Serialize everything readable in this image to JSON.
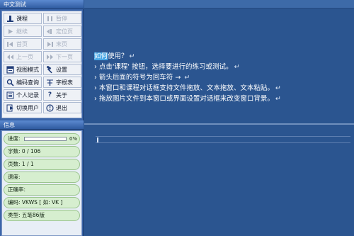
{
  "panel": {
    "title": "中文测试"
  },
  "buttons": [
    {
      "label": "课程",
      "icon": "course-icon",
      "enabled": true
    },
    {
      "label": "暂停",
      "icon": "pause-icon",
      "enabled": false
    },
    {
      "label": "继续",
      "icon": "resume-icon",
      "enabled": false
    },
    {
      "label": "定位页",
      "icon": "locate-page-icon",
      "enabled": false
    },
    {
      "label": "首页",
      "icon": "first-page-icon",
      "enabled": false
    },
    {
      "label": "末页",
      "icon": "last-page-icon",
      "enabled": false
    },
    {
      "label": "上一页",
      "icon": "prev-page-icon",
      "enabled": false
    },
    {
      "label": "下一页",
      "icon": "next-page-icon",
      "enabled": false
    },
    {
      "label": "视图模式",
      "icon": "view-mode-icon",
      "enabled": true
    },
    {
      "label": "设置",
      "icon": "hammer-icon",
      "enabled": true
    },
    {
      "label": "编码查询",
      "icon": "search-icon",
      "enabled": true
    },
    {
      "label": "字根表",
      "icon": "radical-table-icon",
      "enabled": true
    },
    {
      "label": "个人记录",
      "icon": "record-icon",
      "enabled": true
    },
    {
      "label": "关于",
      "icon": "question-icon",
      "enabled": true
    },
    {
      "label": "切换用户",
      "icon": "switch-user-icon",
      "enabled": true
    },
    {
      "label": "退出",
      "icon": "exit-icon",
      "enabled": true
    }
  ],
  "info": {
    "title": "信息",
    "progress_label": "进度:",
    "progress_percent": "0%",
    "progress_value": 0,
    "chars": "字数: 0 / 106",
    "pages": "页数: 1 / 1",
    "speed": "速度:",
    "accuracy": "正确率:",
    "encoding": "编码: VKWS [ 如: VK ]",
    "type": "类型: 五笔86版"
  },
  "content": {
    "line0_hl": "如何",
    "line0_rest": "使用？",
    "line1": "› 点击'课程' 按钮，选择要进行的练习或测试。",
    "line2": "› 箭头后面的符号为回车符 → ",
    "line3": "› 本窗口和课程对话框支持文件拖放、文本拖放、文本粘贴。",
    "line4": "› 拖放图片文件到本窗口或界面设置对话框来改变窗口背景。",
    "return_symbol": "↵"
  },
  "colors": {
    "background": "#2a5592",
    "highlight": "#4aa8e6",
    "info_row": "#d6eecf"
  }
}
